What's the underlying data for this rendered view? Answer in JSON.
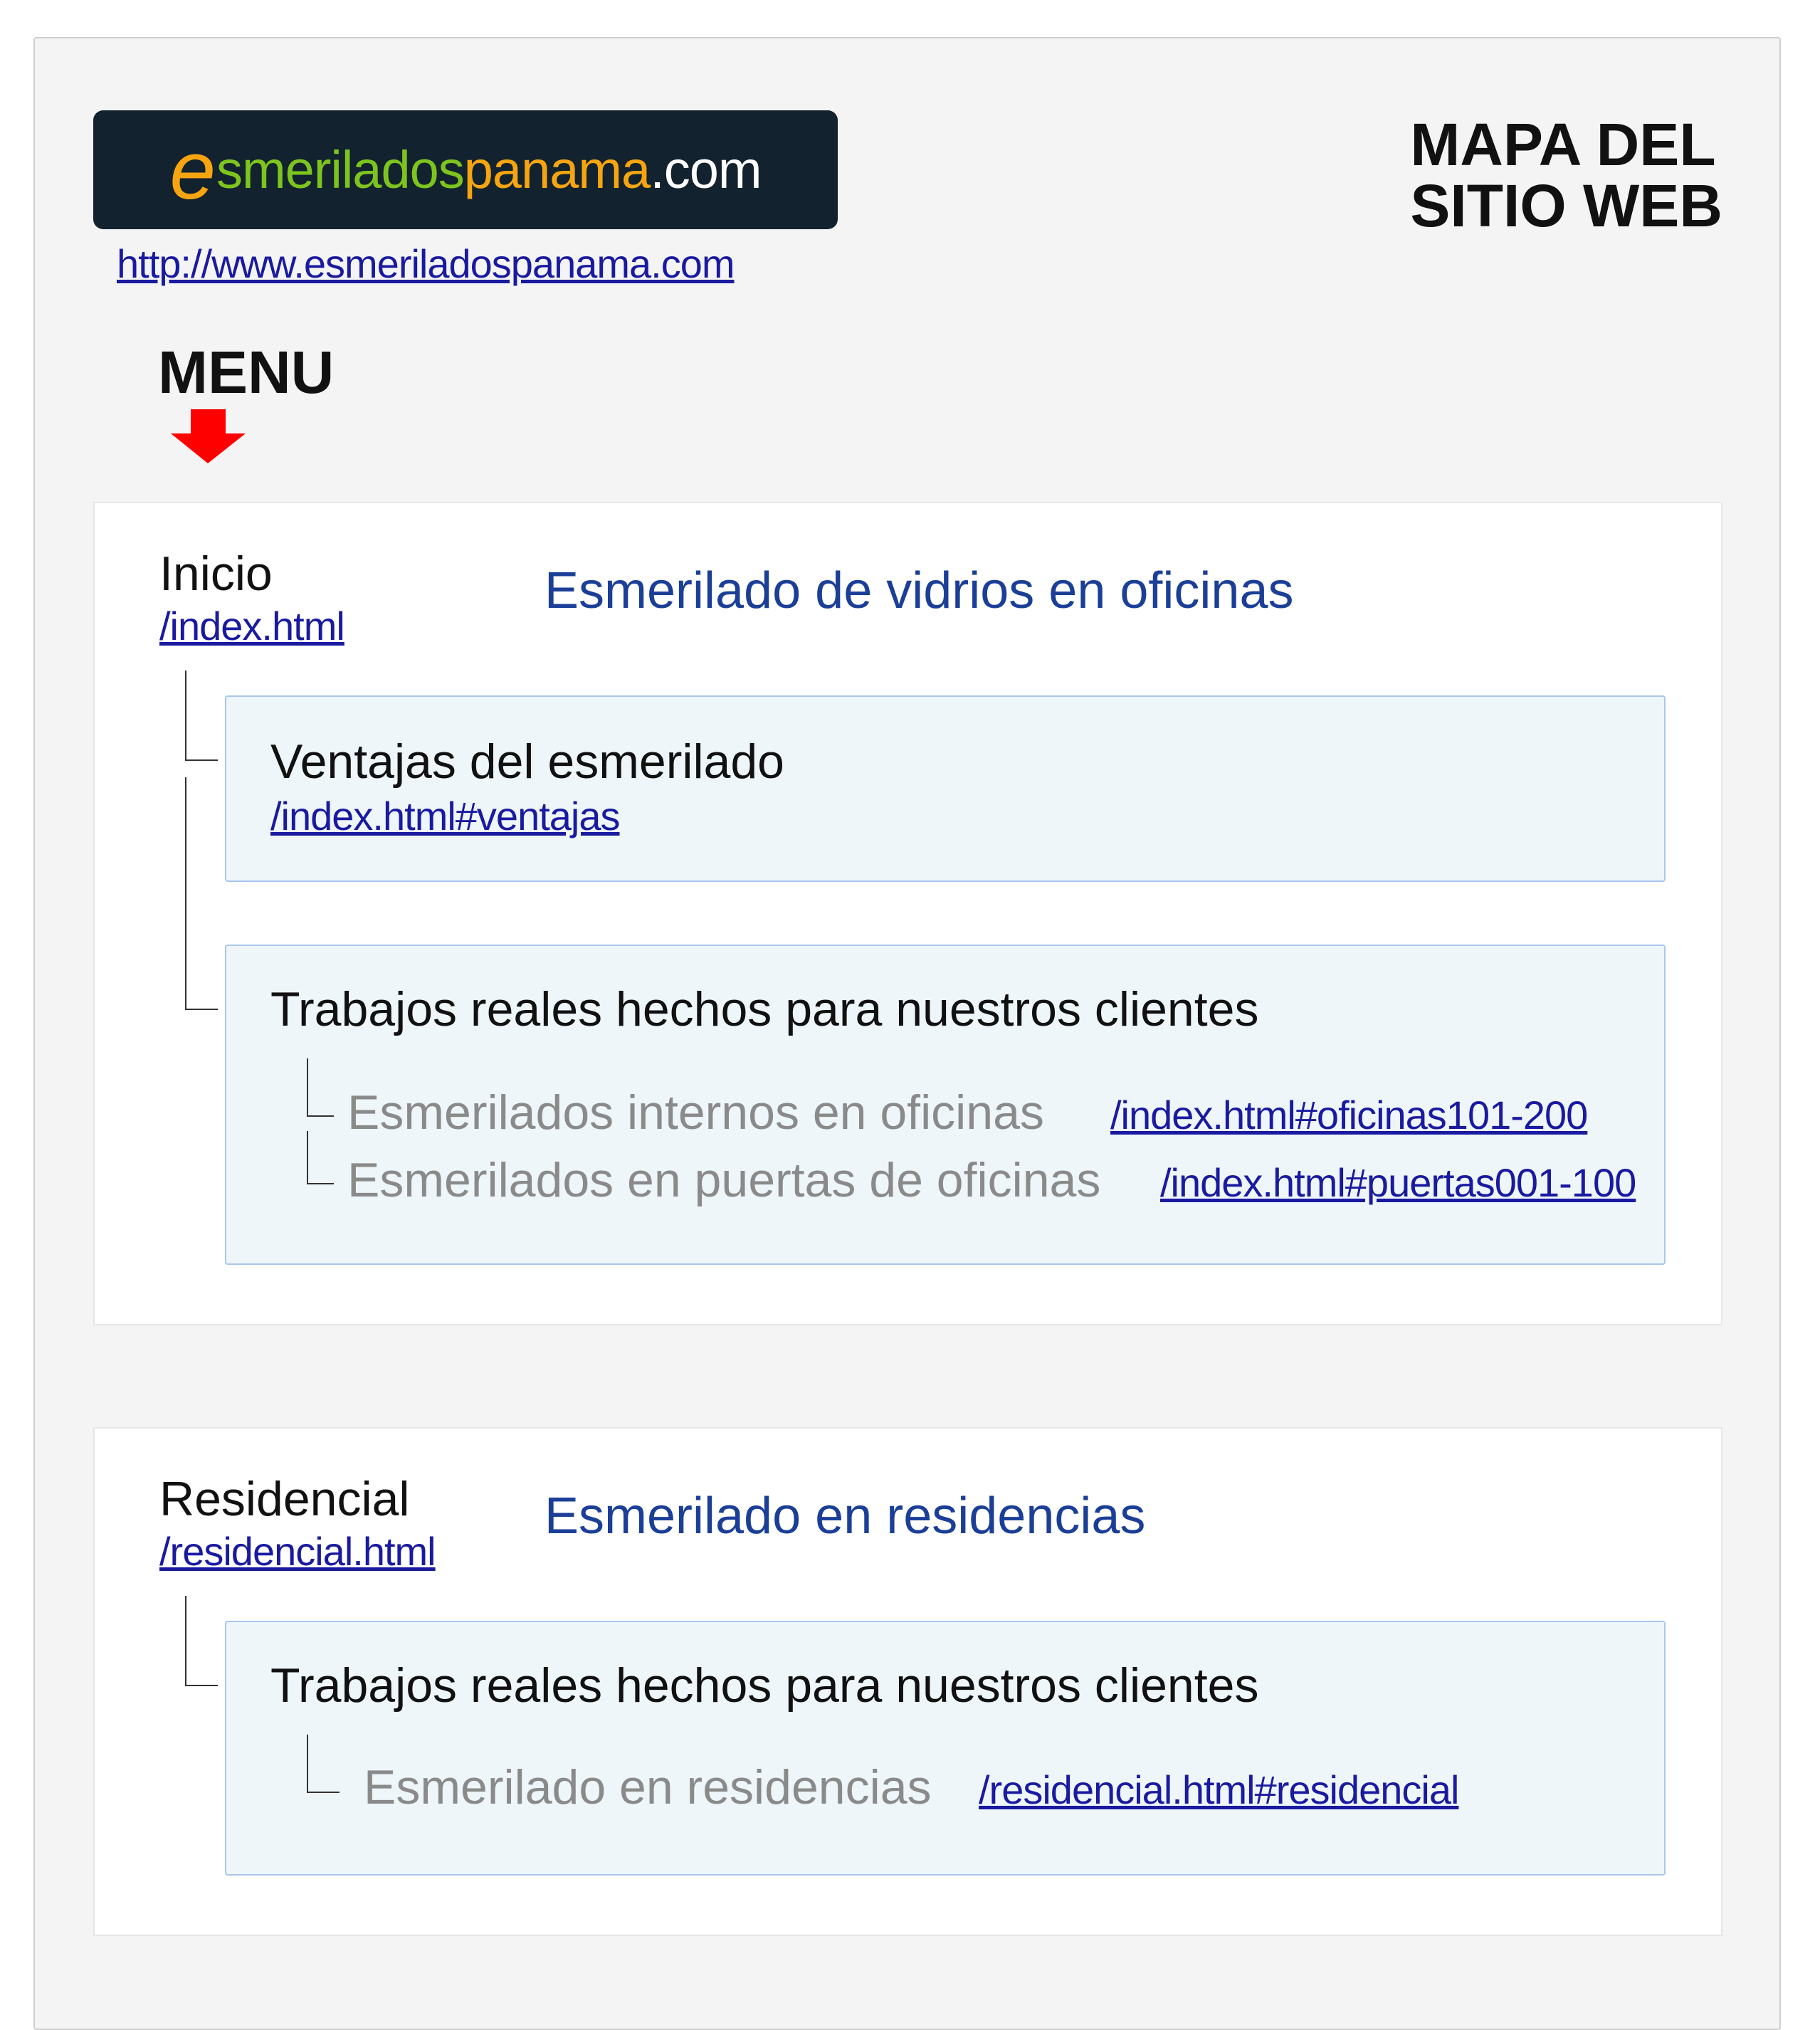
{
  "header": {
    "logo": {
      "e": "e",
      "smerilados": "smerilados",
      "panama": "panama",
      "com": ".com"
    },
    "site_url": "http://www.esmeriladospanama.com",
    "title_line1": "MAPA DEL",
    "title_line2": "SITIO WEB"
  },
  "menu_label": "MENU",
  "arrow_icon": "red-down-arrow",
  "colors": {
    "link": "#1a1aa0",
    "description": "#1b3f97",
    "arrow": "#ff0000",
    "logo_bg": "#12222e",
    "logo_orange": "#f6a511",
    "logo_green": "#7dc51e"
  },
  "pages": [
    {
      "name": "Inicio",
      "link": "/index.html",
      "description": "Esmerilado de vidrios en oficinas",
      "sections": [
        {
          "title": "Ventajas del esmerilado",
          "link": "/index.html#ventajas"
        },
        {
          "title": "Trabajos reales hechos para nuestros clientes",
          "items": [
            {
              "label": "Esmerilados internos en oficinas",
              "link": "/index.html#oficinas101-200"
            },
            {
              "label": "Esmerilados en puertas de oficinas",
              "link": "/index.html#puertas001-100"
            }
          ]
        }
      ]
    },
    {
      "name": "Residencial",
      "link": "/residencial.html",
      "description": "Esmerilado en residencias",
      "sections": [
        {
          "title": "Trabajos reales hechos para nuestros clientes",
          "items": [
            {
              "label": "Esmerilado en residencias",
              "link": "/residencial.html#residencial"
            }
          ]
        }
      ]
    }
  ]
}
